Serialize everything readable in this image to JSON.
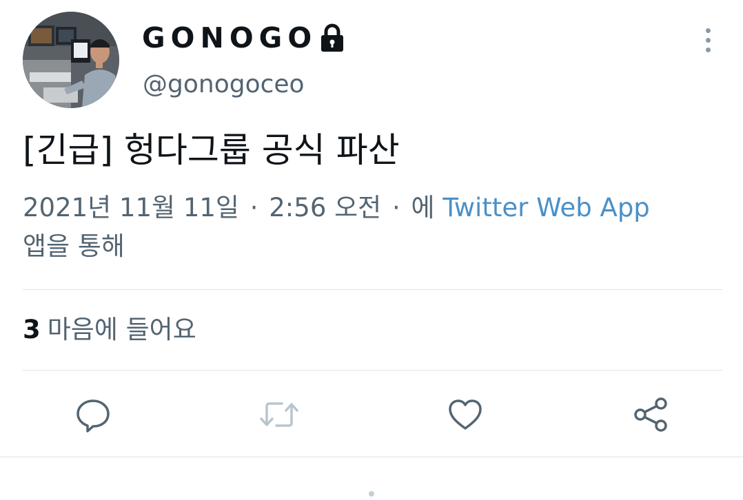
{
  "user": {
    "display_name": "GONOGO",
    "handle": "@gonogoceo",
    "protected_icon": "lock-icon",
    "avatar": "avatar-photo"
  },
  "tweet": {
    "text": "[긴급] 헝다그룹 공식 파산"
  },
  "meta": {
    "date": "2021년 11월 11일",
    "separator": "·",
    "time": "2:56 오전",
    "via_prefix": "에",
    "app": "Twitter Web App",
    "via_suffix": "앱을 통해"
  },
  "stats": {
    "like_count": "3",
    "like_label": "마음에 들어요"
  },
  "actions": [
    {
      "icon": "reply-icon"
    },
    {
      "icon": "retweet-icon"
    },
    {
      "icon": "like-icon"
    },
    {
      "icon": "share-icon"
    }
  ],
  "colors": {
    "text_primary": "#0f1419",
    "text_secondary": "#536471",
    "link": "#4a90c8",
    "divider": "#dde3e8",
    "disabled_icon": "#b8c5cf"
  }
}
